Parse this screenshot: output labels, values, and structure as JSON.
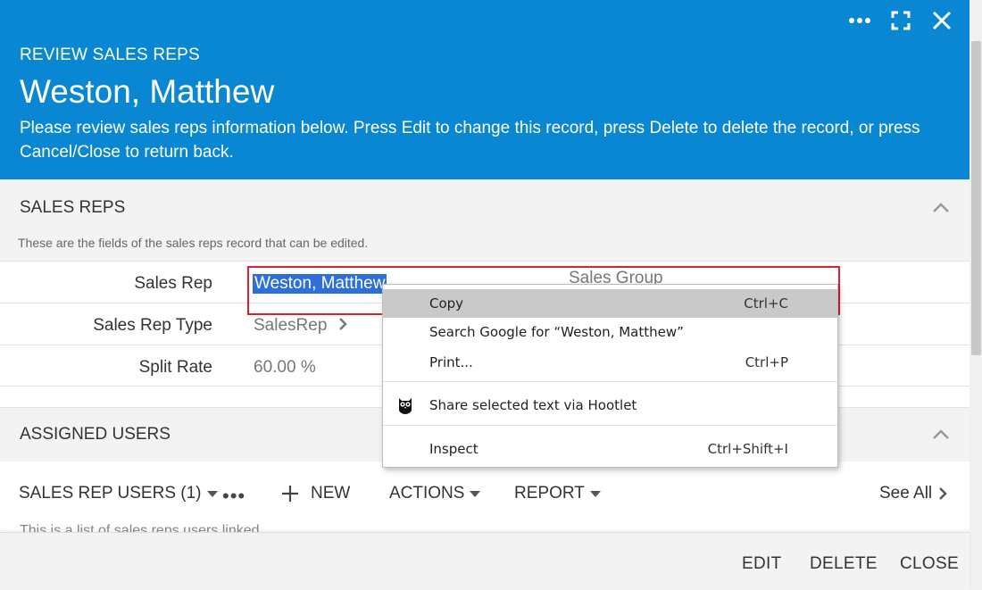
{
  "header": {
    "eyebrow": "REVIEW SALES REPS",
    "title": "Weston, Matthew",
    "description": "Please review sales reps information below. Press Edit to change this record, press Delete to delete the record, or press Cancel/Close to return back.",
    "background_color": "#0a87d2",
    "icons": [
      "more-icon",
      "fullscreen-icon",
      "close-icon"
    ]
  },
  "sales_reps_section": {
    "title": "SALES REPS",
    "subtitle": "These are the fields of the sales reps record that can be edited.",
    "fields": [
      {
        "label": "Sales Rep",
        "value": "Weston, Matthew"
      },
      {
        "label": "Sales Rep Type",
        "value": "SalesRep"
      },
      {
        "label": "Split Rate",
        "value": "60.00 %"
      }
    ],
    "sales_group_label": "Sales Group"
  },
  "assigned_users_section": {
    "title": "ASSIGNED USERS",
    "toolbar": {
      "list_label": "SALES REP USERS (1)",
      "new_label": "NEW",
      "actions_label": "ACTIONS",
      "report_label": "REPORT",
      "see_all_label": "See All"
    },
    "partial_text": "This is a list of sales reps users linked"
  },
  "footer": {
    "edit_label": "EDIT",
    "delete_label": "DELETE",
    "close_label": "CLOSE"
  },
  "context_menu": {
    "items": [
      {
        "label": "Copy",
        "shortcut": "Ctrl+C",
        "highlighted": true
      },
      {
        "label": "Search Google for “Weston, Matthew”",
        "shortcut": ""
      },
      {
        "label": "Print...",
        "shortcut": "Ctrl+P"
      },
      {
        "label": "Share selected text via Hootlet",
        "shortcut": "",
        "icon": "owl-icon"
      },
      {
        "label": "Inspect",
        "shortcut": "Ctrl+Shift+I"
      }
    ]
  },
  "colors": {
    "accent": "#0a87d2",
    "selection": "#2f6fd8",
    "highlight_box": "#e0202f"
  }
}
